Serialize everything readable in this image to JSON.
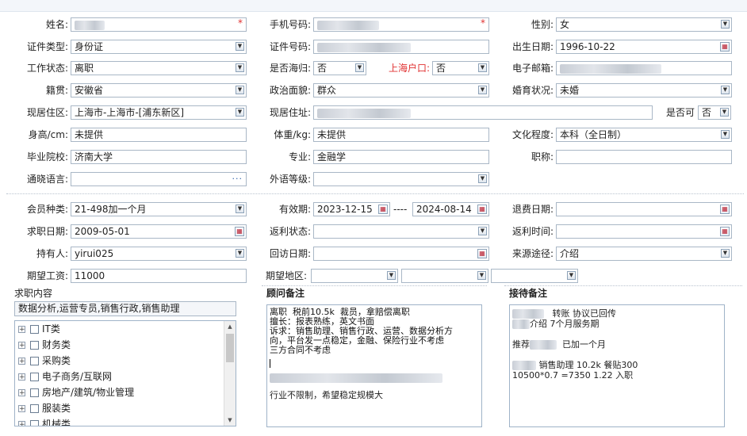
{
  "fields": {
    "name": {
      "label": "姓名:"
    },
    "phone": {
      "label": "手机号码:"
    },
    "gender": {
      "label": "性别:",
      "value": "女"
    },
    "id_type": {
      "label": "证件类型:",
      "value": "身份证"
    },
    "id_number": {
      "label": "证件号码:"
    },
    "birth_date": {
      "label": "出生日期:",
      "value": "1996-10-22"
    },
    "work_status": {
      "label": "工作状态:",
      "value": "离职"
    },
    "returnee": {
      "label": "是否海归:",
      "value": "否"
    },
    "shanghai_hukou": {
      "label": "上海户口:",
      "value": "否"
    },
    "email": {
      "label": "电子邮箱:"
    },
    "native_place": {
      "label": "籍贯:",
      "value": "安徽省"
    },
    "political_status": {
      "label": "政治面貌:",
      "value": "群众"
    },
    "marital_status": {
      "label": "婚育状况:",
      "value": "未婚"
    },
    "current_area": {
      "label": "现居住区:",
      "value": "上海市-上海市-[浦东新区]"
    },
    "current_address": {
      "label": "现居住址:"
    },
    "is_available": {
      "label": "是否可",
      "value": "否"
    },
    "height": {
      "label": "身高/cm:",
      "value": "未提供"
    },
    "weight": {
      "label": "体重/kg:",
      "value": "未提供"
    },
    "education": {
      "label": "文化程度:",
      "value": "本科（全日制）"
    },
    "school": {
      "label": "毕业院校:",
      "value": "济南大学"
    },
    "major": {
      "label": "专业:",
      "value": "金融学"
    },
    "job_title": {
      "label": "职称:",
      "value": ""
    },
    "languages": {
      "label": "通晓语言:",
      "value": "",
      "more_icon": "···"
    },
    "language_level": {
      "label": "外语等级:",
      "value": ""
    },
    "member_type": {
      "label": "会员种类:",
      "value": "21-498加一个月"
    },
    "valid_period": {
      "label": "有效期:",
      "start": "2023-12-15",
      "separator": "----",
      "end": "2024-08-14"
    },
    "refund_date": {
      "label": "退费日期:",
      "value": ""
    },
    "job_search_date": {
      "label": "求职日期:",
      "value": "2009-05-01"
    },
    "rebate_status": {
      "label": "返利状态:",
      "value": ""
    },
    "rebate_time": {
      "label": "返利时间:",
      "value": ""
    },
    "holder": {
      "label": "持有人:",
      "value": "yirui025"
    },
    "followup_date": {
      "label": "回访日期:",
      "value": ""
    },
    "source": {
      "label": "来源途径:",
      "value": "介绍"
    },
    "expected_salary": {
      "label": "期望工资:",
      "value": "11000"
    },
    "expected_area": {
      "label": "期望地区:"
    }
  },
  "job_content": {
    "title": "求职内容",
    "summary": "数据分析,运营专员,销售行政,销售助理",
    "categories": [
      "IT类",
      "财务类",
      "采购类",
      "电子商务/互联网",
      "房地产/建筑/物业管理",
      "服装类",
      "机械类"
    ]
  },
  "consultant_notes": {
    "title": "顾问备注",
    "text": "离职  税前10.5k  裁员，拿赔偿离职\n擅长：报表熟练，英文书面\n诉求：销售助理、销售行政、运营、数据分析方\n向，平台发一点稳定，金融、保险行业不考虑\n三方合同不考虑",
    "text2": "行业不限制，希望稳定规模大"
  },
  "reception_notes": {
    "title": "接待备注",
    "line1": "转账 协议已回传",
    "line2": "介绍   7个月服务期",
    "line3a": "推荐",
    "line3b": "已加一个月",
    "line4": "销售助理 10.2k  餐贴300",
    "line5": "10500*0.7 =7350  1.22 入职"
  },
  "icons": {
    "dropdown": "dropdown-arrow-icon",
    "calendar": "calendar-icon",
    "expand": "tree-expand-icon"
  }
}
